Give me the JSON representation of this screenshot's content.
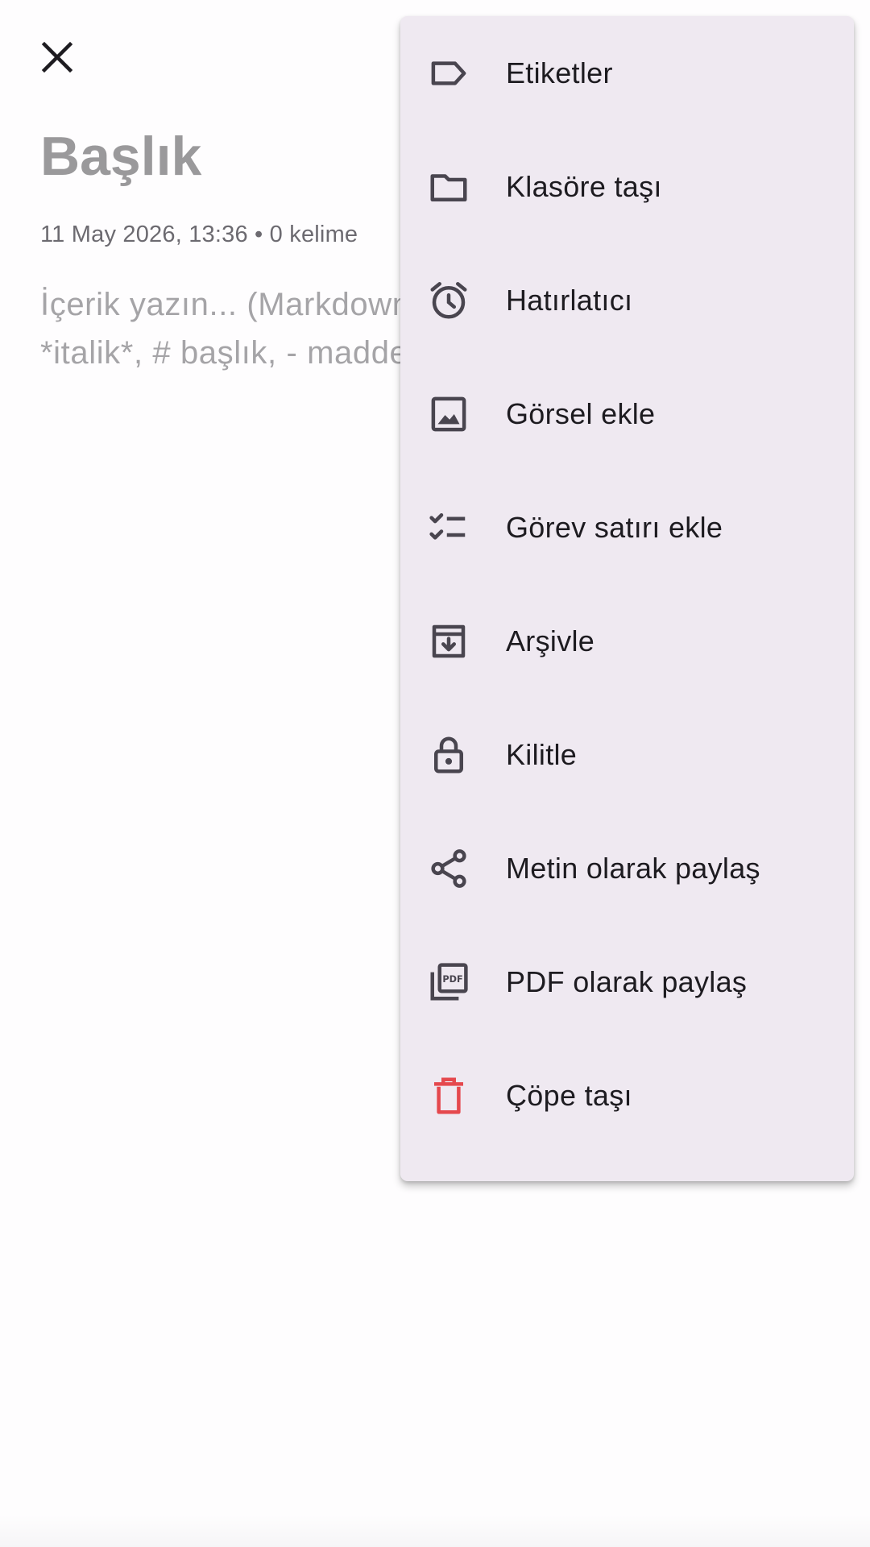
{
  "editor": {
    "title_placeholder": "Başlık",
    "meta": "11 May 2026, 13:36 • 0 kelime",
    "content_placeholder": "İçerik yazın... (Markdown: **kalın**,\n*italik*, # başlık, - madde)"
  },
  "menu": {
    "items": [
      {
        "label": "Etiketler",
        "icon": "label-icon"
      },
      {
        "label": "Klasöre taşı",
        "icon": "folder-icon"
      },
      {
        "label": "Hatırlatıcı",
        "icon": "alarm-icon"
      },
      {
        "label": "Görsel ekle",
        "icon": "image-icon"
      },
      {
        "label": "Görev satırı ekle",
        "icon": "checklist-icon"
      },
      {
        "label": "Arşivle",
        "icon": "archive-icon"
      },
      {
        "label": "Kilitle",
        "icon": "lock-icon"
      },
      {
        "label": "Metin olarak paylaş",
        "icon": "share-icon"
      },
      {
        "label": "PDF olarak paylaş",
        "icon": "pdf-icon"
      },
      {
        "label": "Çöpe taşı",
        "icon": "trash-icon"
      }
    ]
  },
  "colors": {
    "menu_background": "#efe9f1",
    "icon": "#49454f",
    "delete_accent": "#e5484d",
    "text": "#1d1b20",
    "placeholder": "#9a999b"
  }
}
